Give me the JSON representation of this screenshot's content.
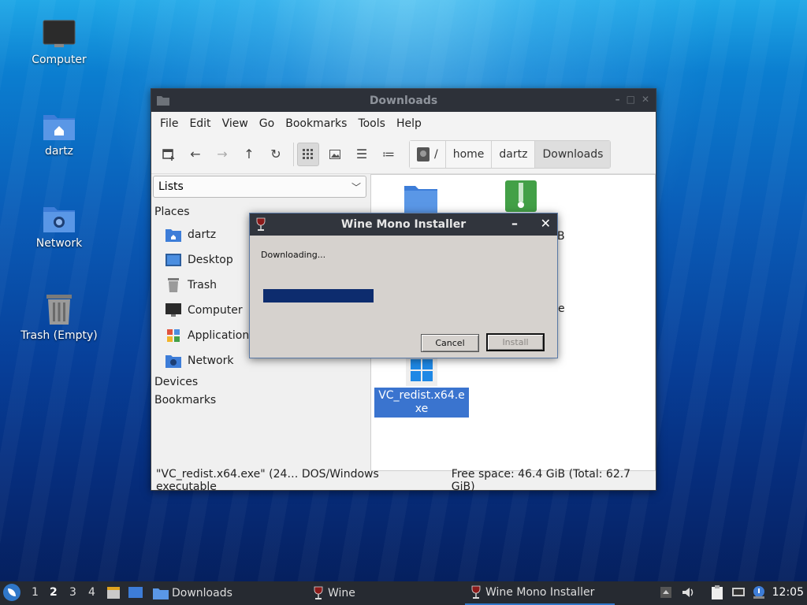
{
  "desktop": {
    "icons": [
      {
        "label": "Computer",
        "icon": "computer-icon"
      },
      {
        "label": "dartz",
        "icon": "home-folder-icon"
      },
      {
        "label": "Network",
        "icon": "network-folder-icon"
      },
      {
        "label": "Trash (Empty)",
        "icon": "trash-icon"
      }
    ]
  },
  "file_manager": {
    "title": "Downloads",
    "menu": [
      "File",
      "Edit",
      "View",
      "Go",
      "Bookmarks",
      "Tools",
      "Help"
    ],
    "breadcrumb": [
      "/",
      "home",
      "dartz",
      "Downloads"
    ],
    "side_combo": "Lists",
    "places_heading": "Places",
    "places": [
      "dartz",
      "Desktop",
      "Trash",
      "Computer",
      "Application",
      "Network"
    ],
    "devices_heading": "Devices",
    "bookmarks_heading": "Bookmarks",
    "files": [
      {
        "name": "",
        "type": "folder"
      },
      {
        "name": "",
        "type": "archive"
      },
      {
        "name": "VC_redist.x64.exe",
        "type": "windows-exe",
        "selected": true
      }
    ],
    "peek_text": {
      "a": "B",
      "b": "e"
    },
    "status_file": "\"VC_redist.x64.exe\" (24… DOS/Windows executable",
    "status_space": "Free space: 46.4 GiB (Total: 62.7 GiB)"
  },
  "wine_dialog": {
    "title": "Wine Mono Installer",
    "message": "Downloading...",
    "progress_percent": 35,
    "cancel_label": "Cancel",
    "install_label": "Install"
  },
  "taskbar": {
    "workspaces": [
      "1",
      "2",
      "3",
      "4"
    ],
    "current_workspace": "2",
    "tasks": [
      {
        "label": "Downloads"
      },
      {
        "label": "Wine"
      },
      {
        "label": "Wine Mono Installer"
      }
    ],
    "clock": "12:05"
  },
  "colors": {
    "accent": "#3a74cf",
    "progress": "#0d2c6e",
    "titlebar": "#2d3139"
  }
}
